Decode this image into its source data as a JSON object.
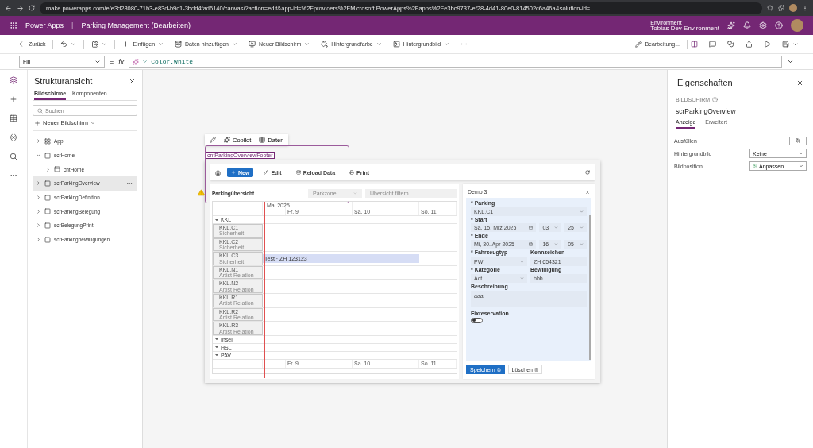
{
  "browser": {
    "url": "make.powerapps.com/e/e3d28080-71b3-e83d-b9c1-3bdd4fad6140/canvas/?action=edit&app-id=%2Fproviders%2FMicrosoft.PowerApps%2Fapps%2Fe3bc9737-ef28-4d41-80e0-814502c6a46a&solution-id=..."
  },
  "header": {
    "product": "Power Apps",
    "separator": "|",
    "title": "Parking Management (Bearbeiten)",
    "environment_label": "Environment",
    "environment": "Tobias Dev Environment"
  },
  "toolbar": {
    "items": [
      {
        "kind": "back",
        "label": "Zurück"
      },
      {
        "kind": "undo"
      },
      {
        "kind": "paste"
      },
      {
        "kind": "insert",
        "label": "Einfügen"
      },
      {
        "kind": "data",
        "label": "Daten hinzufügen"
      },
      {
        "kind": "screen",
        "label": "Neuer Bildschirm"
      },
      {
        "kind": "bgcolor",
        "label": "Hintergrundfarbe"
      },
      {
        "kind": "bgimage",
        "label": "Hintergrundbild"
      },
      {
        "kind": "more"
      }
    ],
    "edit_label": "Bearbeitung..."
  },
  "formula": {
    "property": "Fill",
    "equals": "=",
    "fx": "fx",
    "value": "Color.White"
  },
  "tree": {
    "title": "Strukturansicht",
    "tabs": [
      {
        "label": "Bildschirme",
        "selected": true
      },
      {
        "label": "Komponenten",
        "selected": false
      }
    ],
    "search_placeholder": "Suchen",
    "new_screen": "Neuer Bildschirm",
    "items": [
      {
        "kind": "app",
        "label": "App",
        "expanded": false,
        "selected": false
      },
      {
        "kind": "screen",
        "label": "scrHome",
        "expanded": true,
        "selected": false,
        "children": [
          {
            "kind": "container",
            "label": "cntHome",
            "expanded": false,
            "selected": false
          }
        ]
      },
      {
        "kind": "screen",
        "label": "scrParkingOverview",
        "expanded": false,
        "selected": true
      },
      {
        "kind": "screen",
        "label": "scrParkingDefinition",
        "expanded": false,
        "selected": false
      },
      {
        "kind": "screen",
        "label": "scrParkingBelegung",
        "expanded": false,
        "selected": false
      },
      {
        "kind": "screen",
        "label": "scrBelegungPrint",
        "expanded": false,
        "selected": false
      },
      {
        "kind": "screen",
        "label": "scrParkingbewilligungen",
        "expanded": false,
        "selected": false
      }
    ]
  },
  "canvas": {
    "floating_toolbar": [
      {
        "kind": "copilot",
        "label": "Copilot"
      },
      {
        "kind": "data",
        "label": "Daten"
      }
    ],
    "selected_control": "cntParkingOverviewFooter",
    "app": {
      "commands": [
        {
          "kind": "new",
          "label": "New"
        },
        {
          "kind": "edit",
          "label": "Edit"
        },
        {
          "kind": "reload",
          "label": "Reload Data"
        },
        {
          "kind": "print",
          "label": "Print"
        }
      ],
      "title": "Parkingübersicht",
      "zone_placeholder": "Parkzone",
      "filter_placeholder": "Übersicht filtern",
      "gantt": {
        "month": "Mai 2025",
        "days": [
          "Fr. 9",
          "Sa. 10",
          "So. 11"
        ],
        "footer_days": [
          "Fr. 9",
          "Sa. 10",
          "So. 11"
        ],
        "groups": [
          {
            "label": "KKL",
            "expanded": true,
            "resources": [
              {
                "name": "KKL.C1",
                "role": "Sicherheit"
              },
              {
                "name": "KKL.C2",
                "role": "Sicherheit"
              },
              {
                "name": "KKL.C3",
                "role": "Sicherheit",
                "booking": "Test · ZH 123123"
              },
              {
                "name": "KKL.N1",
                "role": "Artist Relation"
              },
              {
                "name": "KKL.N2",
                "role": "Artist Relation"
              },
              {
                "name": "KKL.R1",
                "role": "Artist Relation"
              },
              {
                "name": "KKL.R2",
                "role": "Artist Relation"
              },
              {
                "name": "KKL.R3",
                "role": "Artist Relation"
              }
            ]
          },
          {
            "label": "Inseli",
            "expanded": true
          },
          {
            "label": "HSL",
            "expanded": true
          },
          {
            "label": "PAV",
            "expanded": true
          }
        ]
      },
      "form": {
        "title": "Demo 3",
        "parking_label": "* Parking",
        "parking": "KKL.C1",
        "start_label": "* Start",
        "start_date": "Sa, 15. Mrz 2025",
        "start_hour": "03",
        "start_minute": "25",
        "end_label": "* Ende",
        "end_date": "Mi, 30. Apr 2025",
        "end_hour": "16",
        "end_minute": "05",
        "vehicle_label": "* Fahrzeugtyp",
        "vehicle": "PW",
        "plate_label": "Kennzeichen",
        "plate": "ZH 654321",
        "category_label": "* Kategorie",
        "category": "Act",
        "permit_label": "Bewilligung",
        "permit": "bbb",
        "description_label": "Beschreibung",
        "description": "aaa",
        "fix_label": "Fixreservation",
        "fix_on": false,
        "save": "Speichern",
        "delete": "Löschen"
      }
    }
  },
  "properties": {
    "title": "Eigenschaften",
    "section": "BILDSCHIRM",
    "screen": "scrParkingOverview",
    "tabs": [
      {
        "label": "Anzeige",
        "selected": true
      },
      {
        "label": "Erweitert",
        "selected": false
      }
    ],
    "fill_label": "Ausfüllen",
    "bgimage_label": "Hintergrundbild",
    "bgimage": "Keine",
    "position_label": "Bildposition",
    "position": "Anpassen"
  }
}
